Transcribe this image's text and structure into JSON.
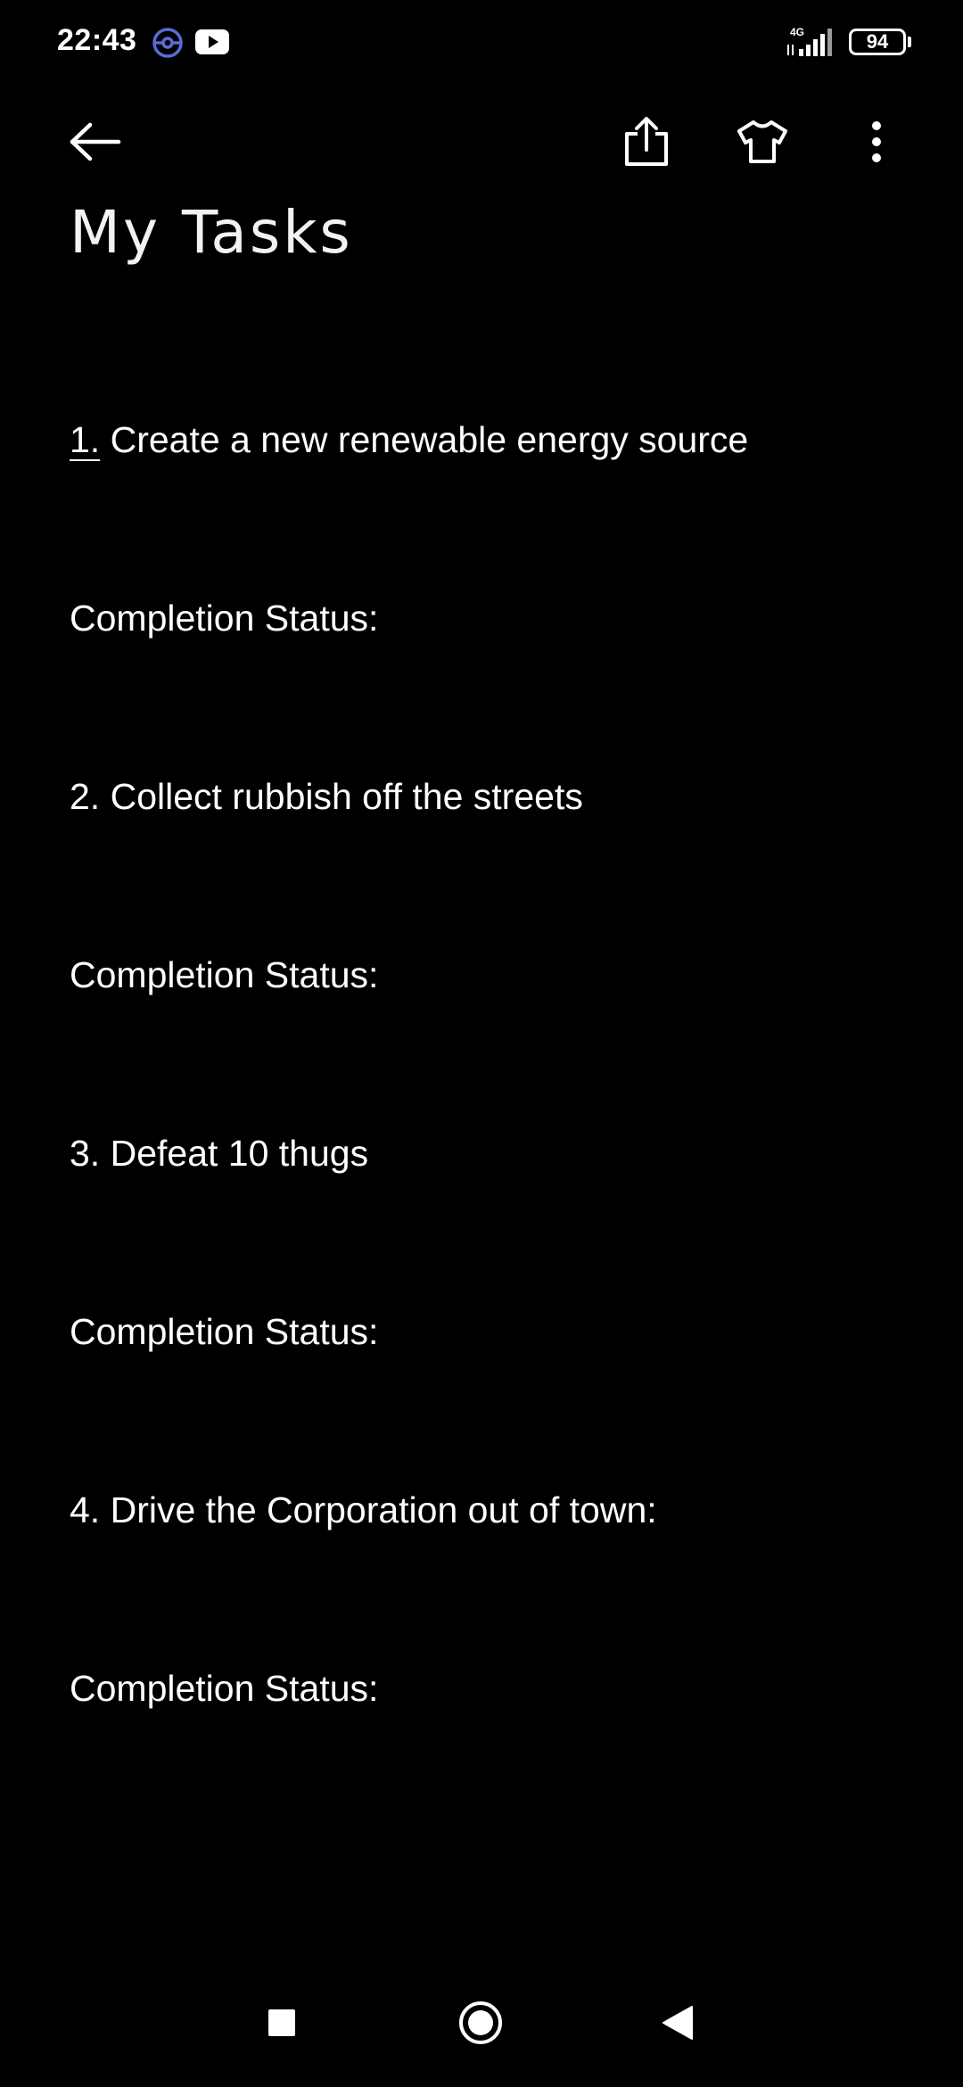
{
  "status_bar": {
    "time": "22:43",
    "network_type": "4G",
    "battery_level": "94",
    "icons": [
      "pokeball-icon",
      "youtube-icon",
      "signal-icon",
      "battery-icon"
    ]
  },
  "toolbar": {
    "icons": [
      "back-arrow-icon",
      "share-icon",
      "tshirt-theme-icon",
      "more-vert-icon"
    ]
  },
  "note": {
    "title": "My Tasks",
    "tasks": [
      {
        "number": "1.",
        "text": " Create a new renewable energy source",
        "status_label": "Completion Status:"
      },
      {
        "number": "2.",
        "text": " Collect rubbish off the streets",
        "status_label": "Completion Status:"
      },
      {
        "number": "3.",
        "text": " Defeat 10 thugs",
        "status_label": "Completion Status:"
      },
      {
        "number": "4.",
        "text": " Drive the Corporation out of town:",
        "status_label": "Completion Status:"
      }
    ]
  },
  "nav_bar": {
    "icons": [
      "recents-square-icon",
      "home-circle-icon",
      "back-triangle-icon"
    ]
  },
  "colors": {
    "background": "#000000",
    "text": "#ffffff",
    "accent_pokeball": "#5b6bd6"
  }
}
